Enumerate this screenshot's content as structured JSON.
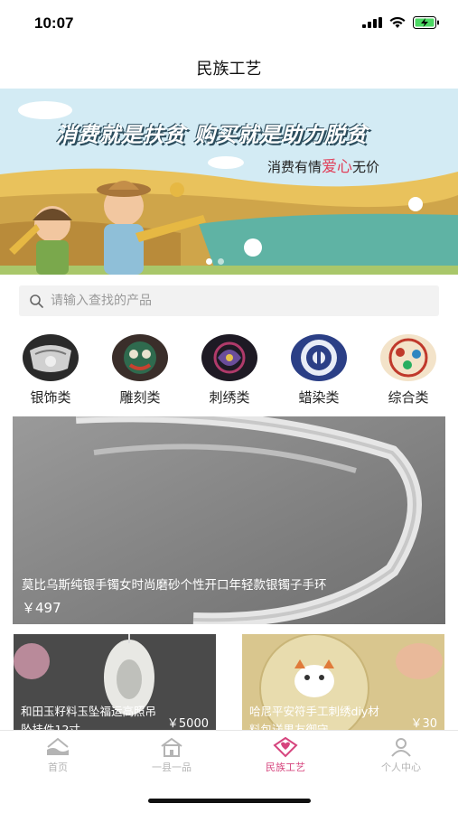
{
  "status_bar": {
    "time": "10:07"
  },
  "nav": {
    "title": "民族工艺"
  },
  "banner": {
    "headline": "消费就是扶贫 购买就是助力脱贫",
    "sub_before": "消费有情",
    "sub_love": "爱心",
    "sub_after": "无价"
  },
  "search": {
    "placeholder": "请输入查找的产品"
  },
  "categories": [
    {
      "label": "银饰类"
    },
    {
      "label": "雕刻类"
    },
    {
      "label": "刺绣类"
    },
    {
      "label": "蜡染类"
    },
    {
      "label": "综合类"
    }
  ],
  "products": [
    {
      "title": "莫比乌斯纯银手镯女时尚磨砂个性开口年轻款银镯子手环",
      "price": "￥497"
    },
    {
      "title": "和田玉籽料玉坠福运高照吊坠挂件12寸",
      "price": "￥5000"
    },
    {
      "title": "哈尼平安符手工刺绣diy材料包送男友御守",
      "price": "￥30"
    }
  ],
  "tabbar": {
    "items": [
      {
        "label": "首页"
      },
      {
        "label": "一县一品"
      },
      {
        "label": "民族工艺"
      },
      {
        "label": "个人中心"
      }
    ]
  },
  "colors": {
    "accent": "#d6457e",
    "tab_inactive": "#b4b4b4"
  }
}
